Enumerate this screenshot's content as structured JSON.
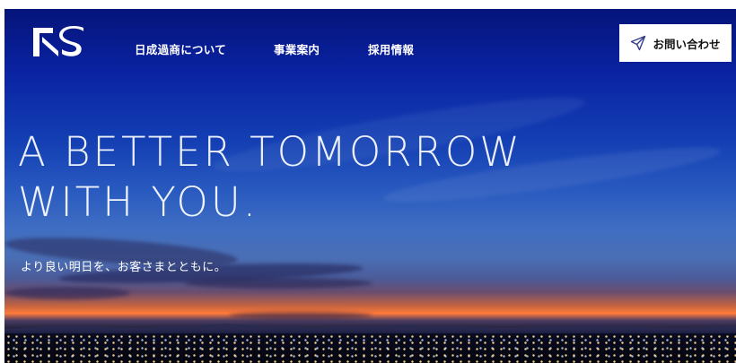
{
  "header": {
    "logo": {
      "text": "NS",
      "icon": "ns-logo-icon"
    },
    "nav": [
      {
        "label": "日成過商について"
      },
      {
        "label": "事業案内"
      },
      {
        "label": "採用情報"
      }
    ],
    "contact_button": {
      "label": "お問い合わせ",
      "icon": "paper-plane-icon"
    }
  },
  "hero": {
    "headline_line1": "A BETTER TOMORROW",
    "headline_line2": "WITH YOU.",
    "tagline": "より良い明日を、お客さまとともに。"
  },
  "colors": {
    "sky_top": "#06147a",
    "sky_mid": "#2a5bc0",
    "sunset": "#ff7a3a",
    "button_bg": "#ffffff",
    "text_light": "#ffffff"
  }
}
